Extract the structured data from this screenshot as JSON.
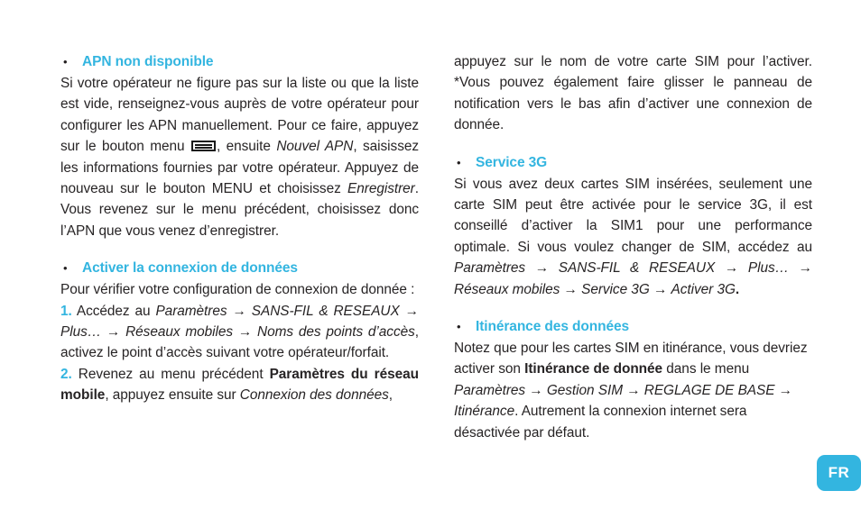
{
  "page": {
    "background_color": "#ffffff",
    "text_color": "#272425",
    "accent_color": "#33b5e0"
  },
  "left_column": {
    "sections": [
      {
        "heading": "APN non disponible",
        "paragraph_parts": [
          {
            "type": "text",
            "text": "Si votre opérateur ne figure pas sur la liste ou que la liste est vide, renseignez-vous auprès de votre opérateur pour configurer les APN manuellement. Pour ce faire, appuyez sur le bouton menu "
          },
          {
            "type": "icon",
            "icon": "menu-button-icon"
          },
          {
            "type": "text",
            "text": ", ensuite "
          },
          {
            "type": "italic",
            "text": "Nouvel APN"
          },
          {
            "type": "text",
            "text": ", saisissez les informations fournies par votre opérateur. Appuyez de nouveau sur le bouton MENU et choisissez "
          },
          {
            "type": "italic",
            "text": "Enregistrer"
          },
          {
            "type": "text",
            "text": ". Vous revenez sur le menu précédent, choisissez donc l’APN que vous venez d’enregistrer."
          }
        ]
      },
      {
        "heading": "Activer la connexion de données",
        "intro": "Pour vérifier votre configuration de connexion de donnée :",
        "steps": [
          {
            "number": "1.",
            "parts": [
              {
                "type": "text",
                "text": " Accédez au "
              },
              {
                "type": "italic",
                "text": "Paramètres"
              },
              {
                "type": "arrow",
                "text": "→"
              },
              {
                "type": "italic",
                "text": "SANS-FIL & RESEAUX"
              },
              {
                "type": "arrow",
                "text": "→"
              },
              {
                "type": "italic",
                "text": "Plus…"
              },
              {
                "type": "arrow",
                "text": "→"
              },
              {
                "type": "italic",
                "text": "Réseaux mobiles"
              },
              {
                "type": "arrow",
                "text": "→"
              },
              {
                "type": "italic",
                "text": "Noms des points d’accès"
              },
              {
                "type": "text",
                "text": ", activez le point d’accès suivant votre opérateur/forfait."
              }
            ]
          },
          {
            "number": "2.",
            "parts": [
              {
                "type": "text",
                "text": " Revenez au menu précédent "
              },
              {
                "type": "bold",
                "text": "Paramètres du réseau mobile"
              },
              {
                "type": "text",
                "text": ", appuyez ensuite sur "
              },
              {
                "type": "italic",
                "text": "Connexion des données"
              },
              {
                "type": "text",
                "text": ","
              }
            ]
          }
        ]
      }
    ]
  },
  "right_column": {
    "continuation": {
      "parts": [
        {
          "type": "text",
          "text": "appuyez sur le nom de votre carte SIM pour l’activer. *Vous pouvez également faire glisser le panneau de notification vers le bas afin d’activer une connexion de donnée."
        }
      ]
    },
    "sections": [
      {
        "heading": "Service 3G",
        "parts": [
          {
            "type": "text",
            "text": "Si vous avez deux cartes SIM insérées, seulement une carte SIM peut être activée pour le service 3G, il est conseillé d’activer la SIM1 pour une performance optimale. Si vous voulez changer de SIM, accédez au "
          },
          {
            "type": "italic",
            "text": "Paramètres"
          },
          {
            "type": "arrow",
            "text": "→"
          },
          {
            "type": "italic",
            "text": "SANS-FIL & RESEAUX"
          },
          {
            "type": "arrow",
            "text": "→"
          },
          {
            "type": "italic",
            "text": "Plus…"
          },
          {
            "type": "arrow",
            "text": "→"
          },
          {
            "type": "italic",
            "text": "Réseaux mobiles"
          },
          {
            "type": "arrow",
            "text": "→"
          },
          {
            "type": "italic",
            "text": "Service 3G"
          },
          {
            "type": "arrow",
            "text": "→"
          },
          {
            "type": "italic",
            "text": "Activer 3G"
          },
          {
            "type": "bold",
            "text": "."
          }
        ]
      },
      {
        "heading": "Itinérance des données",
        "parts": [
          {
            "type": "text",
            "text": "Notez que pour les cartes SIM en itinérance, vous devriez activer son "
          },
          {
            "type": "bold",
            "text": "Itinérance de donnée"
          },
          {
            "type": "text",
            "text": " dans le menu "
          },
          {
            "type": "italic",
            "text": "Paramètres"
          },
          {
            "type": "arrow",
            "text": "→"
          },
          {
            "type": "italic",
            "text": "Gestion SIM"
          },
          {
            "type": "arrow",
            "text": "→"
          },
          {
            "type": "italic",
            "text": "REGLAGE DE BASE"
          },
          {
            "type": "arrow",
            "text": "→"
          },
          {
            "type": "italic",
            "text": "Itinérance"
          },
          {
            "type": "text",
            "text": ". Autrement la connexion internet sera désactivée par défaut."
          }
        ]
      }
    ]
  },
  "language_badge": {
    "label": "FR",
    "background_color": "#33b5e0",
    "text_color": "#ffffff"
  }
}
